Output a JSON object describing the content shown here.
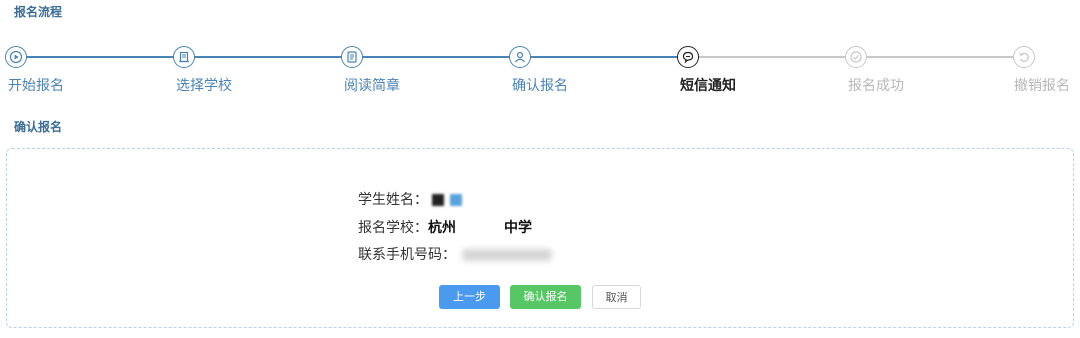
{
  "section1_title": "报名流程",
  "section2_title": "确认报名",
  "colors": {
    "done": "#4a83b5",
    "current": "#222222",
    "todo": "#c8c8c8",
    "confirm_btn": "#57c766",
    "prev_btn": "#4a9af0"
  },
  "steps": [
    {
      "label": "开始报名",
      "status": "done",
      "icon": "play-icon"
    },
    {
      "label": "选择学校",
      "status": "done",
      "icon": "school-icon"
    },
    {
      "label": "阅读简章",
      "status": "done",
      "icon": "document-icon"
    },
    {
      "label": "确认报名",
      "status": "done",
      "icon": "user-confirm-icon"
    },
    {
      "label": "短信通知",
      "status": "current",
      "icon": "chat-icon"
    },
    {
      "label": "报名成功",
      "status": "todo",
      "icon": "check-icon"
    },
    {
      "label": "撤销报名",
      "status": "todo",
      "icon": "undo-icon"
    }
  ],
  "info": {
    "name_label": "学生姓名：",
    "school_label": "报名学校：",
    "school_value_a": "杭州",
    "school_value_b": "中学",
    "phone_label": "联系手机号码："
  },
  "buttons": {
    "prev": "上一步",
    "confirm": "确认报名",
    "cancel": "取消"
  }
}
